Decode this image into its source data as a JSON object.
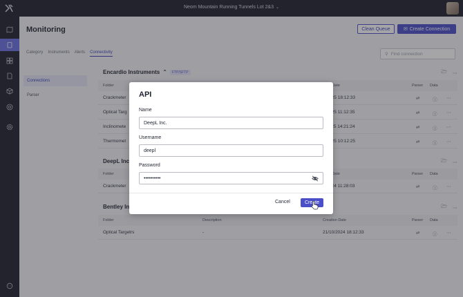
{
  "topbar": {
    "project": "Neom Mountain Running Tunnels Lot 2&3"
  },
  "page": {
    "title": "Monitoring",
    "clean_queue": "Clean Queue",
    "create_connection": "Create Connection",
    "search_placeholder": "Find connection"
  },
  "tabs": [
    "Category",
    "Instruments",
    "Alerts",
    "Connectivity"
  ],
  "subnav": [
    "Connections",
    "Parser"
  ],
  "groups": [
    {
      "title": "Encardio Instruments",
      "badge": "FTP/SFTP",
      "columns": [
        "Folder",
        "Creation Date",
        "Parser",
        "Data"
      ],
      "rows": [
        {
          "folder": "Crackmeter",
          "date": "13/3/2025 18:12:33"
        },
        {
          "folder": "Optical Targ",
          "date": "12/2/2025 11:12:35"
        },
        {
          "folder": "Inclinomete",
          "date": "11/1/2025 14:21:24"
        },
        {
          "folder": "Thermomet",
          "date": "21/1/2025 10:12:25"
        }
      ]
    },
    {
      "title": "DeepL Inc",
      "columns": [
        "Folder",
        "Creation Date",
        "Parser",
        "Data"
      ],
      "rows": [
        {
          "folder": "Crackmeter",
          "date": "21/1/2024 11:28:03"
        }
      ]
    },
    {
      "title": "Bentley In",
      "columns": [
        "Folder",
        "Description",
        "Creation Date",
        "Parser",
        "Data"
      ],
      "rows": [
        {
          "folder": "Optical Targetrs",
          "description": "-",
          "date": "21/10/2024 18:12:33"
        }
      ]
    }
  ],
  "dialog": {
    "title": "API",
    "name_label": "Name",
    "name_value": "DeepL Inc.",
    "username_label": "Username",
    "username_value": "deepl",
    "password_label": "Password",
    "password_value": "••••••••••",
    "cancel": "Cancel",
    "create": "Create"
  },
  "colors": {
    "accent": "#4a4fc9",
    "sidebar": "#1e1f2b"
  }
}
